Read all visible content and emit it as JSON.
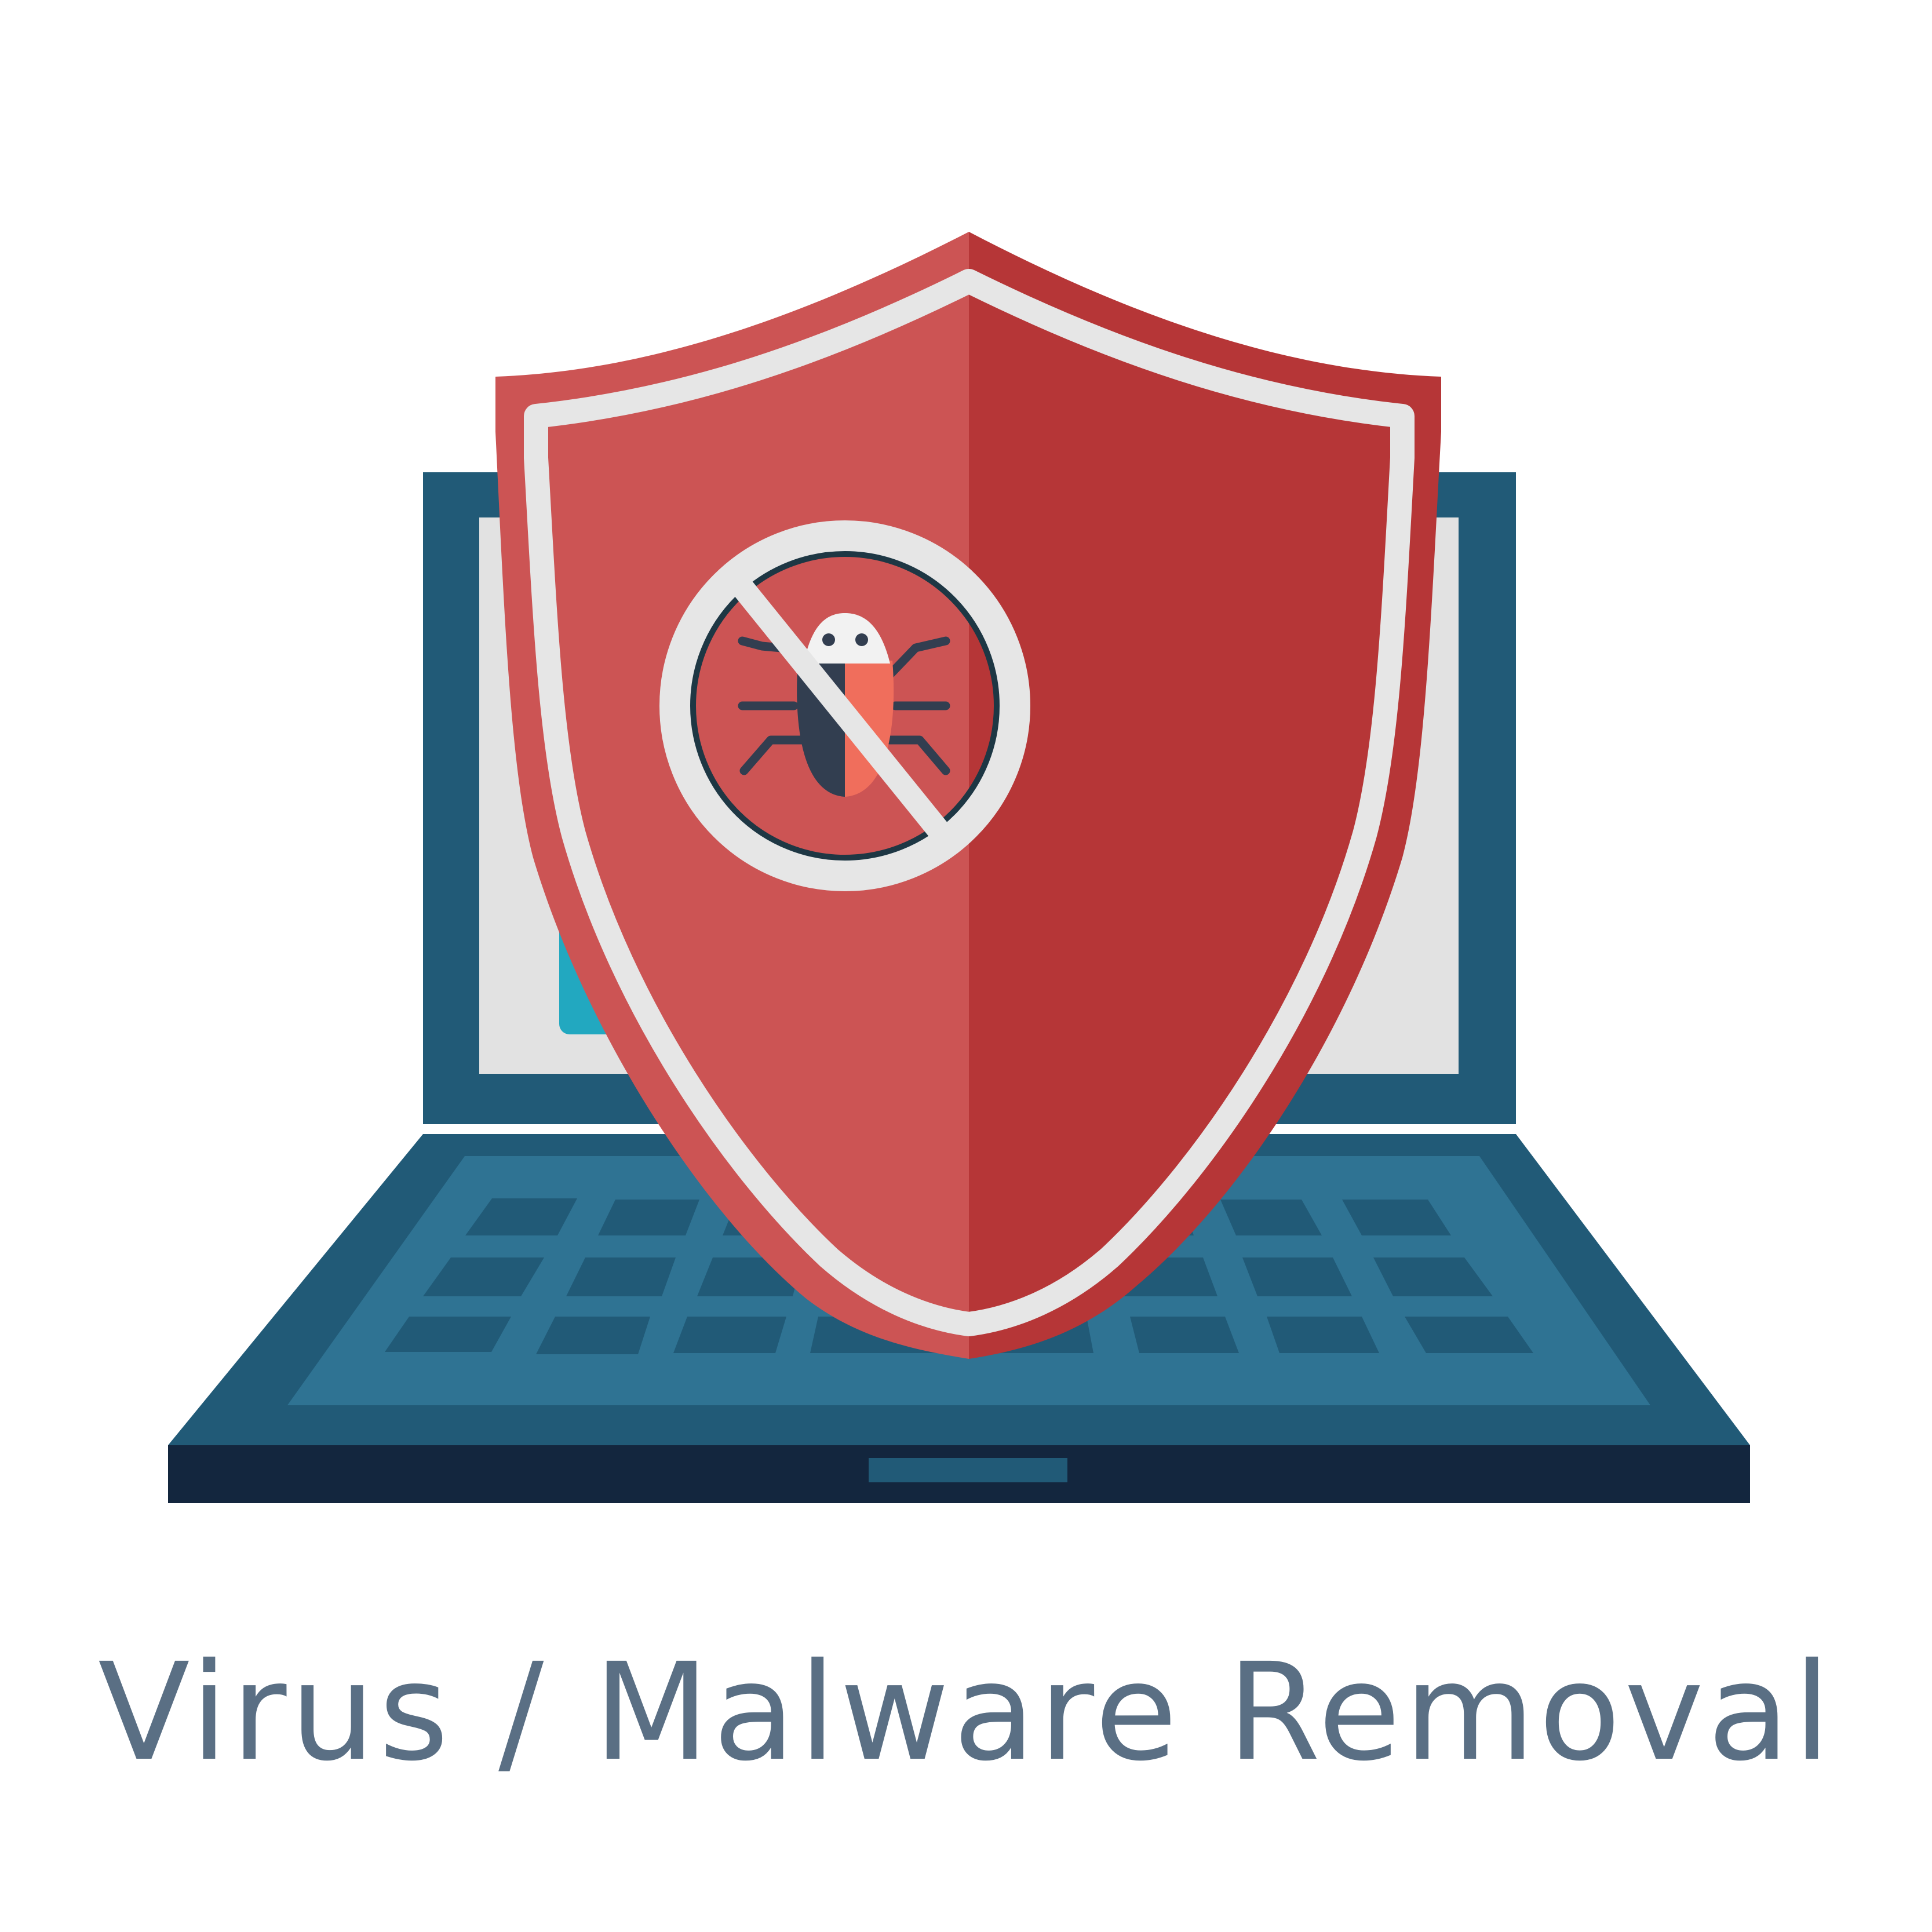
{
  "caption": {
    "text": "Virus / Malware Removal"
  },
  "icons": {
    "laptop": "laptop-icon",
    "shield": "shield-icon",
    "bug": "bug-icon",
    "prohibited": "no-entry-icon"
  },
  "colors": {
    "background": "#ffffff",
    "caption_text": "#5a6f84",
    "laptop_frame": "#215a77",
    "laptop_keyboard": "#2f7393",
    "laptop_keys": "#215a77",
    "laptop_base": "#13263e",
    "screen": "#e2e2e2",
    "screen_window": "#22a8c0",
    "shield_left": "#cc5454",
    "shield_right": "#b63637",
    "shield_border": "#e6e6e6",
    "bug_dark": "#323e50",
    "bug_body": "#f06e5c",
    "bug_head": "#f2f2f2"
  }
}
